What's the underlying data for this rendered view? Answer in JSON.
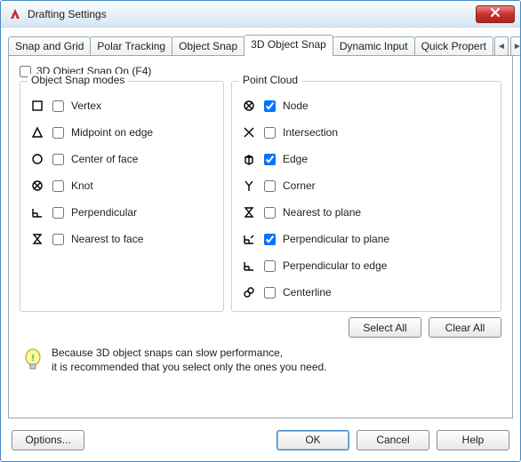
{
  "window": {
    "title": "Drafting Settings"
  },
  "tabs": {
    "items": [
      {
        "label": "Snap and Grid"
      },
      {
        "label": "Polar Tracking"
      },
      {
        "label": "Object Snap"
      },
      {
        "label": "3D Object Snap"
      },
      {
        "label": "Dynamic Input"
      },
      {
        "label": "Quick Propert"
      }
    ],
    "active_index": 3
  },
  "master_toggle": {
    "label": "3D Object Snap On (F4)",
    "checked": false
  },
  "groups": {
    "left": {
      "legend": "Object Snap modes"
    },
    "right": {
      "legend": "Point Cloud"
    }
  },
  "object_snap_modes": [
    {
      "key": "vertex",
      "label": "Vertex",
      "checked": false,
      "glyph": "square"
    },
    {
      "key": "midpoint-edge",
      "label": "Midpoint on edge",
      "checked": false,
      "glyph": "triangle"
    },
    {
      "key": "center-face",
      "label": "Center of face",
      "checked": false,
      "glyph": "circle"
    },
    {
      "key": "knot",
      "label": "Knot",
      "checked": false,
      "glyph": "circle-x"
    },
    {
      "key": "perpendicular",
      "label": "Perpendicular",
      "checked": false,
      "glyph": "perp"
    },
    {
      "key": "nearest-face",
      "label": "Nearest to face",
      "checked": false,
      "glyph": "hourglass"
    }
  ],
  "point_cloud": [
    {
      "key": "node",
      "label": "Node",
      "checked": true,
      "glyph": "circle-x"
    },
    {
      "key": "intersection",
      "label": "Intersection",
      "checked": false,
      "glyph": "x"
    },
    {
      "key": "edge",
      "label": "Edge",
      "checked": true,
      "glyph": "cube"
    },
    {
      "key": "corner",
      "label": "Corner",
      "checked": false,
      "glyph": "y"
    },
    {
      "key": "nearest-plane",
      "label": "Nearest to plane",
      "checked": false,
      "glyph": "hourglass"
    },
    {
      "key": "perp-plane",
      "label": "Perpendicular to plane",
      "checked": true,
      "glyph": "perp-plane"
    },
    {
      "key": "perp-edge",
      "label": "Perpendicular to edge",
      "checked": false,
      "glyph": "perp"
    },
    {
      "key": "centerline",
      "label": "Centerline",
      "checked": false,
      "glyph": "link"
    }
  ],
  "buttons": {
    "select_all": "Select All",
    "clear_all": "Clear All",
    "options": "Options...",
    "ok": "OK",
    "cancel": "Cancel",
    "help": "Help"
  },
  "tip": {
    "line1": "Because 3D object snaps can slow performance,",
    "line2": "it is recommended that you select only the ones you need."
  }
}
